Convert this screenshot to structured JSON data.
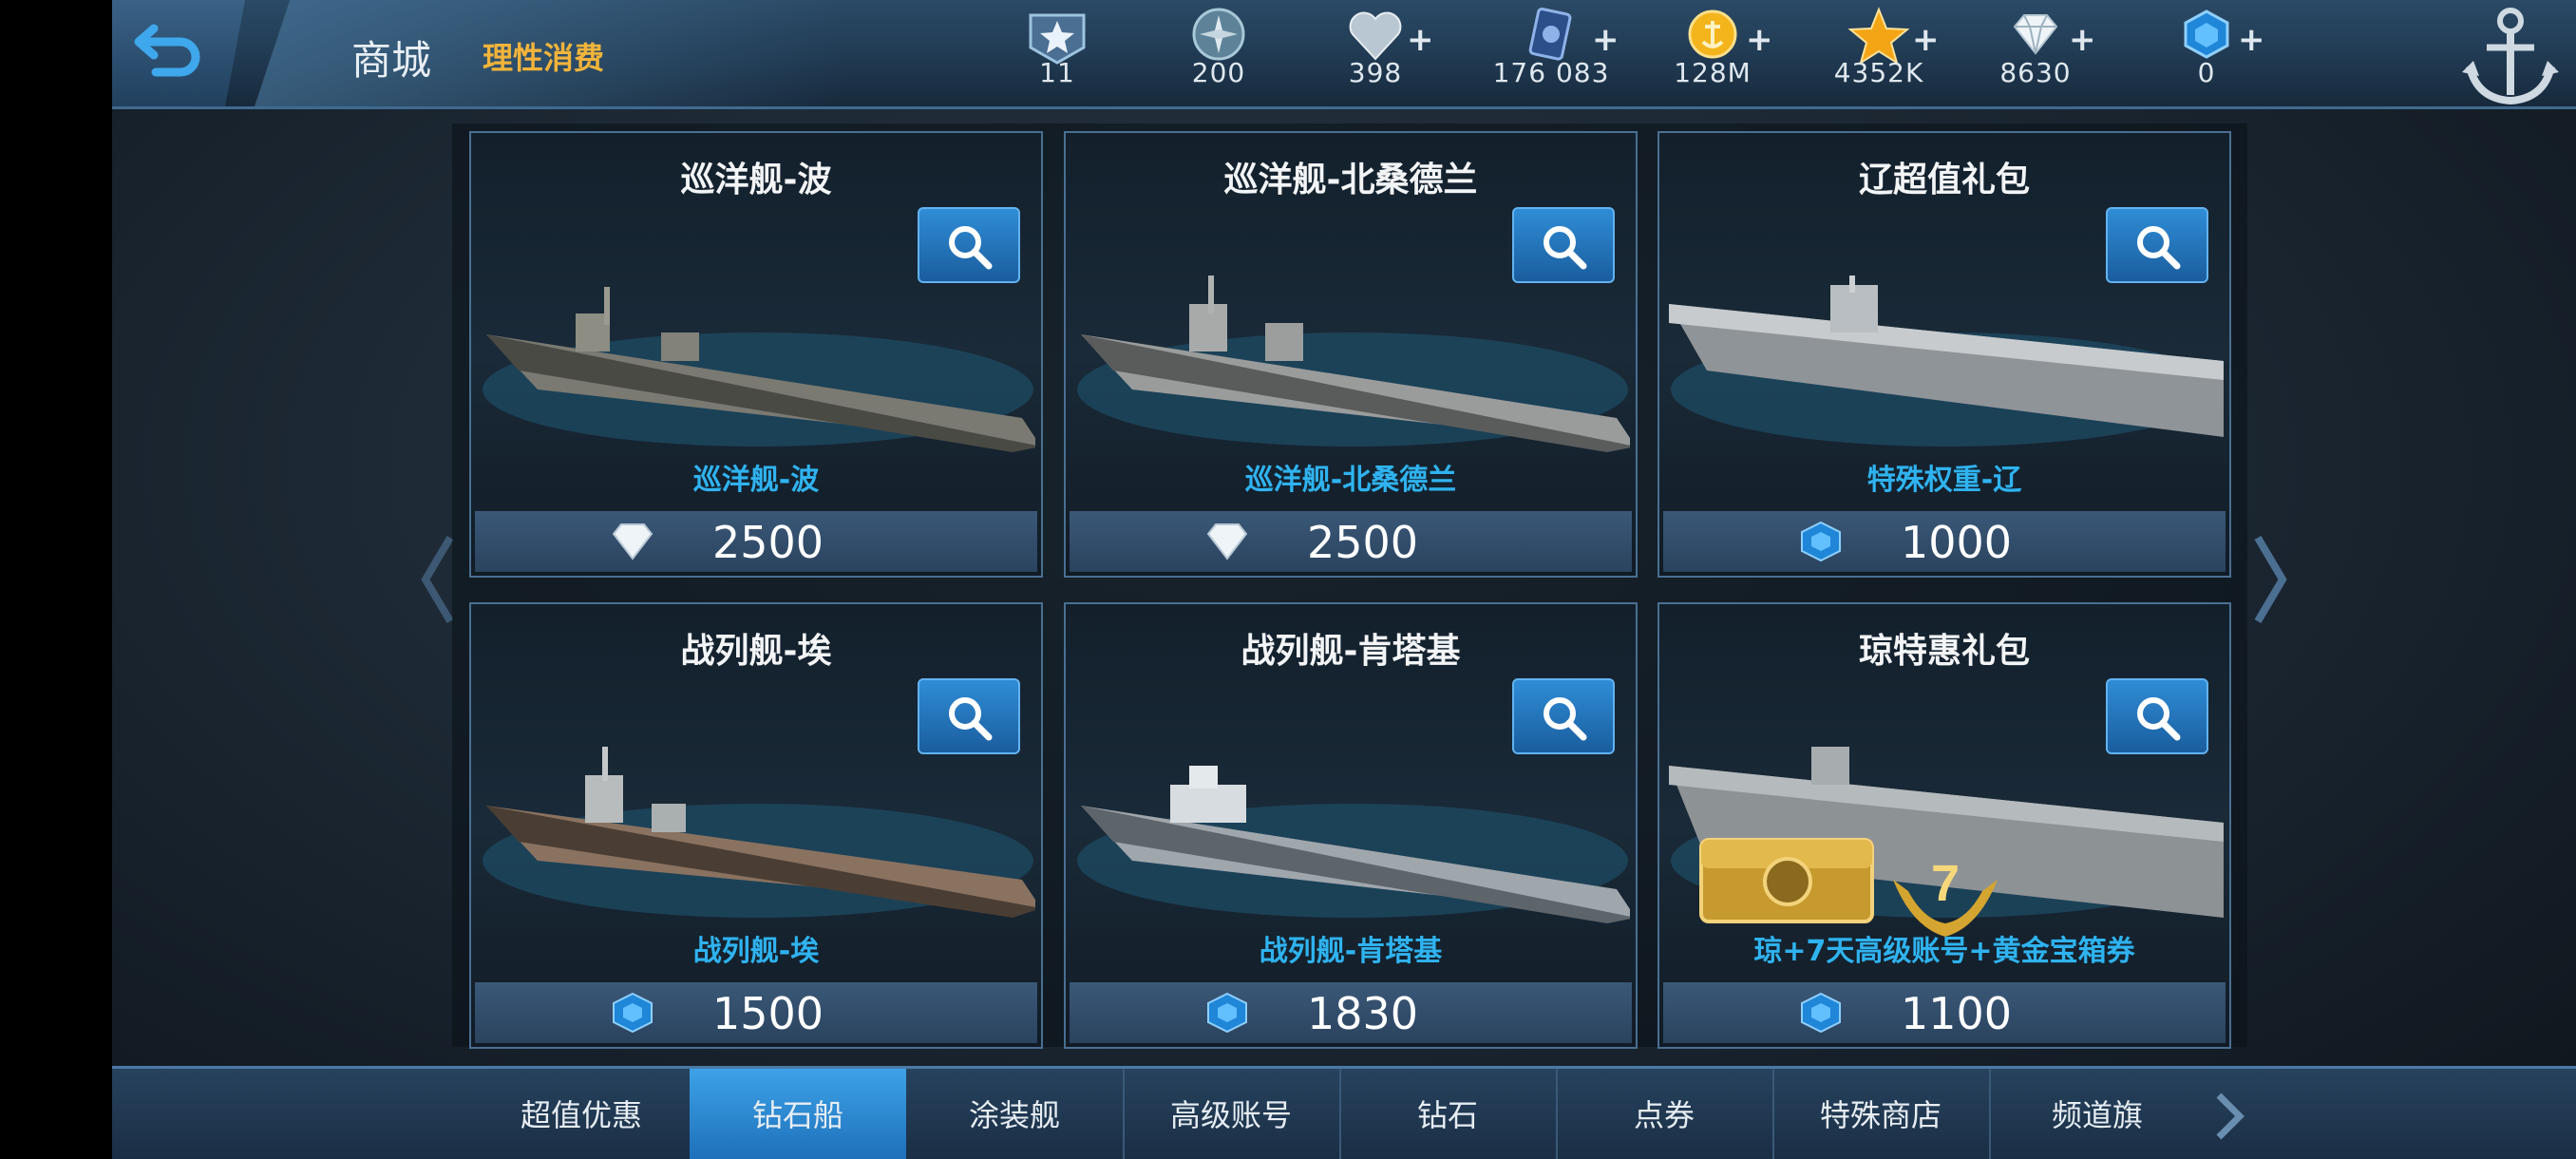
{
  "header": {
    "title": "商城",
    "subtitle": "理性消费"
  },
  "resources": [
    {
      "name": "rank-star-icon",
      "value": "11",
      "plus": false
    },
    {
      "name": "compass-token-icon",
      "value": "200",
      "plus": false
    },
    {
      "name": "heart-icon",
      "value": "398",
      "plus": true
    },
    {
      "name": "card-icon",
      "value": "176 083",
      "plus": true
    },
    {
      "name": "gold-coin-icon",
      "value": "128M",
      "plus": true
    },
    {
      "name": "gold-star-icon",
      "value": "4352K",
      "plus": true
    },
    {
      "name": "diamond-icon",
      "value": "8630",
      "plus": true
    },
    {
      "name": "blue-gem-icon",
      "value": "0",
      "plus": true
    }
  ],
  "cards": [
    {
      "name": "巡洋舰-波",
      "sub": "巡洋舰-波",
      "currency": "diamond-icon",
      "price": "2500"
    },
    {
      "name": "巡洋舰-北桑德兰",
      "sub": "巡洋舰-北桑德兰",
      "currency": "diamond-icon",
      "price": "2500"
    },
    {
      "name": "辽超值礼包",
      "sub": "特殊权重-辽",
      "currency": "blue-gem-icon",
      "price": "1000"
    },
    {
      "name": "战列舰-埃",
      "sub": "战列舰-埃",
      "currency": "blue-gem-icon",
      "price": "1500"
    },
    {
      "name": "战列舰-肯塔基",
      "sub": "战列舰-肯塔基",
      "currency": "blue-gem-icon",
      "price": "1830"
    },
    {
      "name": "琼特惠礼包",
      "sub": "琼+7天高级账号+黄金宝箱券",
      "currency": "blue-gem-icon",
      "price": "1100",
      "badge": "7"
    }
  ],
  "tabs": [
    {
      "label": "超值优惠",
      "active": false
    },
    {
      "label": "钻石船",
      "active": true
    },
    {
      "label": "涂装舰",
      "active": false
    },
    {
      "label": "高级账号",
      "active": false
    },
    {
      "label": "钻石",
      "active": false
    },
    {
      "label": "点券",
      "active": false
    },
    {
      "label": "特殊商店",
      "active": false
    },
    {
      "label": "频道旗",
      "active": false
    }
  ],
  "colors": {
    "accent": "#2f8dd6",
    "subtitle": "#f2b43a",
    "ship_label": "#2fb3f0"
  }
}
